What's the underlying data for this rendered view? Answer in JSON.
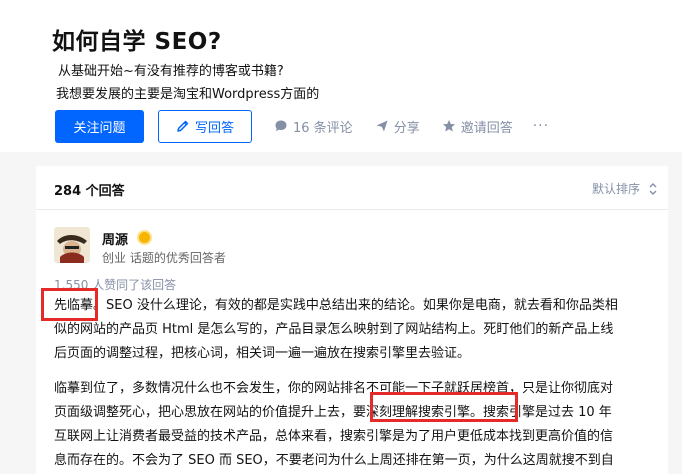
{
  "question": {
    "title": "如何自学 SEO?",
    "line1": "从基础开始~有没有推荐的博客或书籍?",
    "line2": "我想要发展的主要是淘宝和Wordpress方面的"
  },
  "actions": {
    "follow_label": "关注问题",
    "answer_label": "写回答",
    "comments_label": "16 条评论",
    "share_label": "分享",
    "invite_label": "邀请回答",
    "more_label": "···"
  },
  "answers": {
    "count_label": "284 个回答",
    "sort_label": "默认排序"
  },
  "answer": {
    "author_name": "周源",
    "author_desc": "创业 话题的优秀回答者",
    "votes": "1,550 人赞同了该回答",
    "p1_lines": [
      "先临摹。SEO 没什么理论，有效的都是实践中总结出来的结论。如果你是电商，就去看和你品类相",
      "似的网站的产品页 Html 是怎么写的，产品目录怎么映射到了网站结构上。死盯他们的新产品上线",
      "后页面的调整过程，把核心词，相关词一遍一遍放在搜索引擎里去验证。"
    ],
    "p2_lines": [
      "临摹到位了，多数情况什么也不会发生，你的网站排名不可能一下子就跃居榜首，只是让你彻底对",
      "页面级调整死心，把心思放在网站的价值提升上去，要深刻理解搜索引擎。搜索引擎是过去 10 年",
      "互联网上让消费者最受益的技术产品，总体来看，搜索引擎是为了用户更低成本找到更高价值的信",
      "息而存在的。不会为了 SEO 而 SEO，不要老问为什么上周还排在第一页，为什么这周就搜不到自"
    ]
  },
  "colors": {
    "brand_blue": "#0066ff",
    "highlight_red": "#e52a2a",
    "muted": "#8590a6"
  }
}
